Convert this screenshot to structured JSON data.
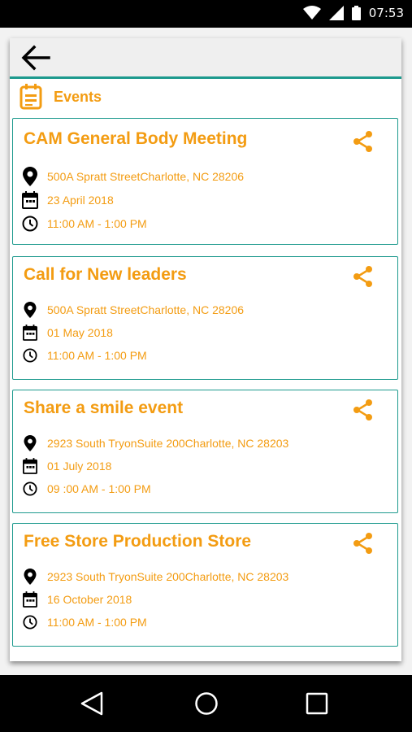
{
  "status": {
    "time": "07:53"
  },
  "header": {
    "title": "Events"
  },
  "events": [
    {
      "title": "CAM General Body Meeting",
      "address": "500A Spratt StreetCharlotte, NC 28206",
      "date": "23 April 2018",
      "time": "11:00 AM - 1:00 PM"
    },
    {
      "title": "Call for New leaders",
      "address": "500A Spratt StreetCharlotte, NC 28206",
      "date": "01 May 2018",
      "time": "11:00 AM - 1:00 PM"
    },
    {
      "title": "Share a smile event",
      "address": "2923 South TryonSuite 200Charlotte, NC 28203",
      "date": "01 July 2018",
      "time": "09 :00 AM - 1:00 PM"
    },
    {
      "title": "Free Store Production Store",
      "address": "2923 South TryonSuite 200Charlotte, NC 28203",
      "date": "16 October 2018",
      "time": "11:00 AM - 1:00 PM"
    }
  ],
  "colors": {
    "accent": "#f39c12",
    "teal": "#1e9a8e"
  },
  "icons": [
    "back-arrow-icon",
    "calendar-icon",
    "share-icon",
    "location-pin-icon",
    "time-icon",
    "nav-back-icon",
    "nav-home-icon",
    "nav-recents-icon"
  ]
}
